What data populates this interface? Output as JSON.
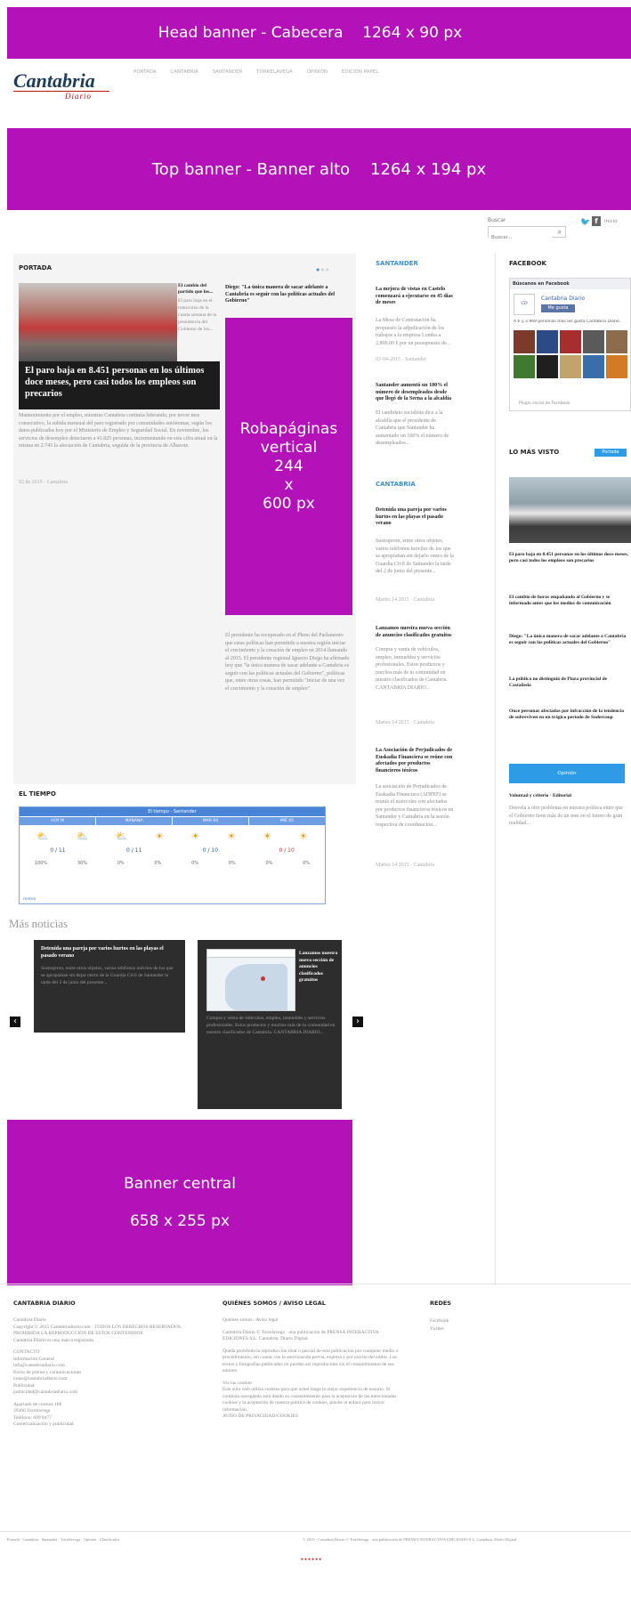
{
  "banners": {
    "head": "Head banner - Cabecera    1264 x 90 px",
    "top": "Top banner - Banner alto    1264 x 194 px",
    "robapaginas": {
      "line1": "Robapáginas",
      "line2": "vertical",
      "line3": "244",
      "line4": "x",
      "line5": "600 px"
    },
    "central": {
      "line1": "Banner central",
      "line2": "658 x 255 px"
    }
  },
  "logo": {
    "main": "Cantabria",
    "sub": "Diario"
  },
  "nav": [
    "PORTADA",
    "CANTABRIA",
    "SANTANDER",
    "TORRELAVEGA",
    "OPINIÓN",
    "EDICIÓN PAPEL"
  ],
  "search": {
    "label": "Buscar",
    "placeholder": "Buscar..."
  },
  "social": {
    "twitter": "Twitter",
    "facebook": "Facebook",
    "rss": "Inicio"
  },
  "portada": {
    "title": "PORTADA",
    "main_headline": "El paro baja en 8.451 personas en los últimos doce meses, pero casi todos los empleos son precarios",
    "main_text": "Mantenimiento por el empleo, mientras Cantabria continúa liderando, por tercer mes consecutivo, la subida mensual del paro registrado por comunidades autónomas, según los datos publicados hoy por el Ministerio de Empleo y Seguridad Social. En noviembre, los servicios de desempleo detectaron a 41.825 personas, incrementando en esta cifra anual en la misma en 2.745 la afectación de Cantabria, seguida de la provincia de Albacete.",
    "main_meta": "02 de 2015 · Cantabria",
    "side_headline": "El cambio del partido que los...",
    "side_text": "El paro baja en el transcurso de la cuarta semana de la presidencia del Gobierno de los...",
    "diego_headline": "Diego: \"La única manera de sacar adelante a Cantabria es seguir con las políticas actuales del Gobierno\"",
    "diego_text": "El presidente ha recuperado en el Pleno del Parlamento que estas políticas han permitido a nuestra región iniciar el crecimiento y la creación de empleo en 2014 llamando al 2015. El presidente regional Ignacio Diego ha afirmado hoy que \"la única manera de sacar adelante a Cantabria es seguir con las políticas actuales del Gobierno\", políticas que, entre otras cosas, han permitido \"iniciar de una vez el crecimiento y la creación de empleo\"."
  },
  "santander": {
    "title": "SANTANDER",
    "items": [
      {
        "headline": "La mejora de vistas en Castelo comenzará a ejecutarse en 45 días de meses",
        "text": "La Mesa de Contratación ha propuesto la adjudicación de los trabajos a la empresa Lomba a 2,800.00 € por un presupuesto de...",
        "meta": "02-04-2015 · Santander"
      },
      {
        "headline": "Santander aumentó un 100% el número de desempleados desde que llegó de la Serna a la alcaldía",
        "text": "El candidato socialista dice a la alcaldía que el presidente de Cantabria que Santander ha aumentado un 100% el número de desempleados..."
      }
    ]
  },
  "cantabria": {
    "title": "CANTABRIA",
    "items": [
      {
        "headline": "Detenida una pareja por varios hurtos en las playas el pasado verano",
        "text": "Sustrajeron, entre otros objetos, varios teléfonos móviles de los que se apropiaban sin dejarlo rastro de la Guardia Civil de Santander la tarde del 2 de junio del presente...",
        "meta": "Martes 14 2015 · Cantabria"
      },
      {
        "headline": "Lanzamos nuestra nueva sección de anuncios clasificados gratuitos",
        "text": "Compra y venta de vehículos, empleo, inmuebles y servicios profesionales. Estos productos y muchos más de tu comunidad en nuestro clasificados de Cantabria. CANTABRIA DIARIO...",
        "meta": "Martes 14 2015 · Cantabria"
      },
      {
        "headline": "La Asociación de Perjudicados de Euskadia Financiera se reúne con afectados por productos financieros tóxicos",
        "text": "La asociación de Perjudicados de Euskadia Financiera (ADPEF) se reunió el miércoles con afectados por productos financieros tóxicos en Santander y Cantabria en la sesión respectiva de coordinación...",
        "meta": "Martes 14 2015 · Cantabria"
      }
    ]
  },
  "facebook": {
    "title": "FACEBOOK",
    "header": "Búscanos en Facebook",
    "page_name": "Cantabria Diario",
    "like_button": "Me gusta",
    "likes_text": "A ti y 3.969 personas más les gusta Cantabria Diario.",
    "plugin_text": "Plugin social de Facebook"
  },
  "mas_visto": {
    "title": "LO MÁS VISTO",
    "badge": "Portada",
    "items": [
      "El paro baja en 8.451 personas en los últimos doce meses, pero casi todos los empleos son precarios",
      "El cambio de horas empañando al Gobierno y se informado antes que los medios de comunicación",
      "Diego: \"La única manera de sacar adelante a Cantabria es seguir con las políticas actuales del Gobierno\"",
      "La pública no distinguió de Plaza provincial de Castañeda",
      "Once personas afectadas por infracción de la tendencia de sobreviven en un trágico período de Sodercoop"
    ],
    "button": "Opinión",
    "editorial_title": "Voluntad y criterio · Editorial",
    "editorial_text": "Desvela a otro problema en nuestra política entre que el Gobierno tiene más de un mes en el futuro de gran realidad..."
  },
  "tiempo": {
    "title": "EL TIEMPO",
    "widget_title": "El tiempo - Santander",
    "days": [
      "HOY M",
      "MAÑANA",
      "MAR 04",
      "MIÉ 05",
      "JUE 06"
    ],
    "temps": [
      "0 / 11",
      "0 / 11",
      "0 / 10",
      "0 / 10"
    ],
    "percents": [
      "100%",
      "30%",
      "0%",
      "0%",
      "0%",
      "0%",
      "0%",
      "0%"
    ],
    "footer": "meteo"
  },
  "mas_noticias": {
    "title": "Más noticias",
    "card1": {
      "headline": "Detenida una pareja por varios hurtos en las playas el pasado verano",
      "text": "Sustrajeron, entre otros objetos, varios teléfonos móviles de los que se apropiaban sin dejar rastro de la Guardia Civil de Santander la tarde del 2 de junio del presente..."
    },
    "card2": {
      "headline": "Lanzamos nuestra nueva sección de anuncios clasificados gratuitos",
      "text": "Compra y venta de vehículos, empleo, inmuebles y servicios profesionales. Estos productos y muchos más de tu comunidad en nuestro clasificados de Cantabria. CANTABRIA DIARIO..."
    },
    "prev": "‹",
    "next": "›"
  },
  "footer": {
    "col1": {
      "title": "CANTABRIA DIARIO",
      "lines": [
        "Cantabria Diario",
        "Copyright © 2015 Cantabriadiario.com · TODOS LOS DERECHOS RESERVADOS. PROHIBIDA LA REPRODUCCIÓN DE ESTOS CONTENIDOS",
        "Cantabria Diario es una marca registrada",
        "CONTACTO",
        "Información General",
        "info@cantabriadiario.com",
        "Envío de prensa y comunicaciones",
        "notas@cantabriadiario.com",
        "Publicidad",
        "publicidad@cantabriadiario.com",
        "Apartado de correos 188",
        "39300 Torrelavega",
        "Teléfono: 699 8477",
        "Comercialización y publicidad"
      ]
    },
    "col2": {
      "title": "QUIÉNES SOMOS / AVISO LEGAL",
      "lines": [
        "Quiénes somos / Aviso legal",
        "Cantabria Diario © Torrelavega · una publicación de PRENSA INTERACTIVA EDICIONES S.L. Cantabria, Diario Digital",
        "Queda prohibida la reproducción total o parcial de esta publicación por cualquier medio o procedimiento, sin contar con la autorización previa, expresa y por escrito del editor. Los textos y fotografías publicados no pueden ser reproducidos sin el consentimiento de sus autores.",
        "Ver las cookies",
        "Este sitio web utiliza cookies para que usted tenga la mejor experiencia de usuario. Si continúa navegando está dando su consentimiento para la aceptación de las mencionadas cookies y la aceptación de nuestra política de cookies, pinche el enlace para mayor información.",
        "AVISO DE PRIVACIDAD/COOKIES"
      ]
    },
    "col3": {
      "title": "REDES",
      "lines": [
        "Facebook",
        "Twitter"
      ]
    },
    "bottom_links": [
      "Portada",
      "Cantabria",
      "Santander",
      "Torrelavega",
      "Opinión",
      "Clasificados"
    ],
    "copyright": "© 2015 · Cantabria Diario © Torrelavega · una publicación de PRENSA INTERACTIVA EDICIONES S.L. Cantabria, Diario Digital"
  }
}
